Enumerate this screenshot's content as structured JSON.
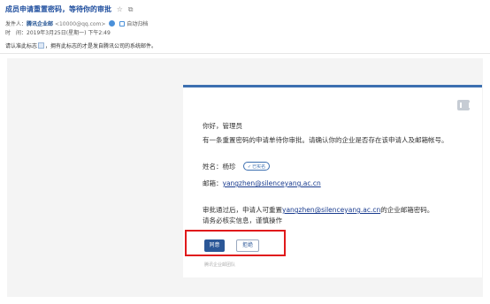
{
  "email": {
    "subject": "成员申请重置密码，等待你的审批",
    "sender_label": "发件人：",
    "sender_name": "腾讯企业邮",
    "sender_addr": "<10000@qq.com>",
    "auto_reply": "自动归档",
    "time_label": "时　间：",
    "time_value": "2019年3月25日(星期一) 下午2:49",
    "notice_pre": "请认准此标志",
    "notice_post": "，拥有此标志的才是发自腾讯公司的系统邮件。"
  },
  "card": {
    "greeting": "你好，管理员",
    "intro": "有一条重置密码的申请单待你审批。请确认你的企业是否存在该申请人及邮箱帐号。",
    "name_label": "姓名：",
    "name_value": "杨珍",
    "verified": "已实名",
    "mail_label": "邮箱：",
    "mail_value": "yangzhen@silenceyang.ac.cn",
    "note1_pre": "审批通过后，申请人可重置",
    "note1_mail": "yangzhen@silenceyang.ac.cn",
    "note1_post": "的企业邮箱密码。",
    "note2": "请务必核实信息，谨慎操作",
    "approve_label": "同意",
    "reject_label": "拒绝",
    "footer": "腾讯企业邮团队"
  }
}
